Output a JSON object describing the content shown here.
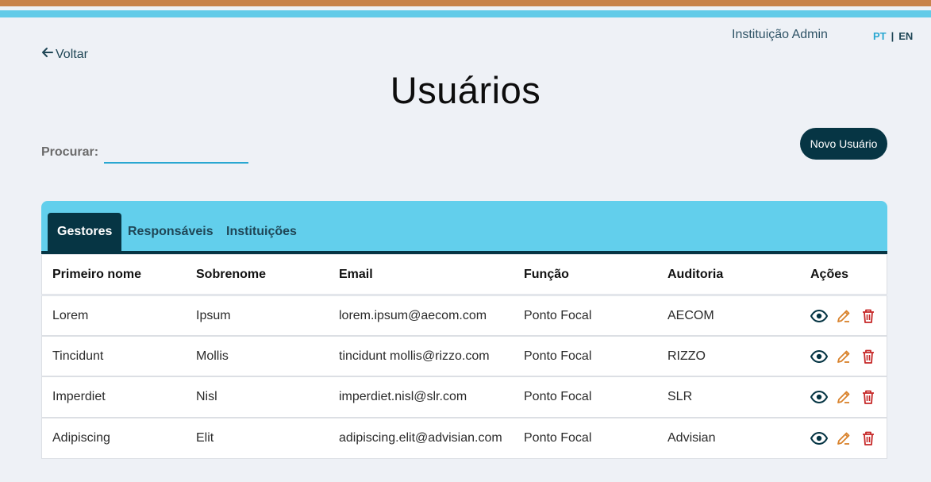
{
  "header": {
    "institution": "Instituição Admin",
    "lang_pt": "PT",
    "lang_sep": "|",
    "lang_en": "EN",
    "back_label": "Voltar"
  },
  "page": {
    "title": "Usuários",
    "search_label": "Procurar:",
    "search_value": "",
    "new_user_label": "Novo Usuário"
  },
  "tabs": [
    "Gestores",
    "Responsáveis",
    "Instituições"
  ],
  "active_tab": "Gestores",
  "table": {
    "columns": [
      "Primeiro nome",
      "Sobrenome",
      "Email",
      "Função",
      "Auditoria",
      "Ações"
    ],
    "rows": [
      [
        "Lorem",
        "Ipsum",
        "lorem.ipsum@aecom.com",
        "Ponto Focal",
        "AECOM"
      ],
      [
        "Tincidunt",
        "Mollis",
        "tincidunt mollis@rizzo.com",
        "Ponto Focal",
        "RIZZO"
      ],
      [
        "Imperdiet",
        "Nisl",
        "imperdiet.nisl@slr.com",
        "Ponto Focal",
        "SLR"
      ],
      [
        "Adipiscing",
        "Elit",
        "adipiscing.elit@advisian.com",
        "Ponto Focal",
        "Advisian"
      ]
    ]
  },
  "colors": {
    "accent_dark": "#063544",
    "accent_light": "#62cfec",
    "stripe_orange": "#c8834a",
    "edit_icon": "#d9822b",
    "delete_icon": "#c62828"
  },
  "icons": [
    "arrow-left-icon",
    "eye-icon",
    "pencil-icon",
    "trash-icon"
  ]
}
